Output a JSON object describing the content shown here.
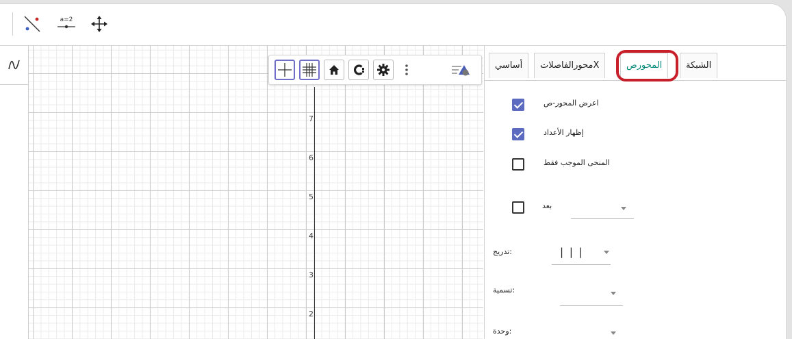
{
  "toolbar": {
    "tools": [
      "line-point-icon",
      "slider-icon",
      "move-graphics-icon"
    ],
    "slider_label": "a=2"
  },
  "algebra": {
    "icon": "function-icon"
  },
  "graphics": {
    "toolbar_buttons": [
      "axes-icon",
      "grid-icon",
      "home-icon",
      "c-icon",
      "settings-icon",
      "more-icon",
      "style-bar-icon"
    ],
    "y_ticks": [
      "7",
      "6",
      "5",
      "4",
      "3",
      "2"
    ]
  },
  "properties": {
    "tabs": {
      "grid": "الشبكة",
      "y_axis": "المحورص",
      "x_axis": "محورالفاصلاتX",
      "basic": "أساسي"
    },
    "show_y_axis": {
      "label": "اعرض المحور-ص",
      "checked": true
    },
    "show_numbers": {
      "label": "إظهار الأعداد",
      "checked": true
    },
    "positive_only": {
      "label": "المنحى الموجب فقط",
      "checked": false
    },
    "distance": {
      "label": "بعد",
      "checked": false,
      "value": ""
    },
    "ticks": {
      "label": ":تدريج",
      "value": "| | |"
    },
    "label_field": {
      "label": ":تسمية",
      "value": ""
    },
    "unit": {
      "label": ":وحدة",
      "value": ""
    }
  },
  "colors": {
    "accent": "#5c6bc0",
    "selected_tab": "#00897b",
    "highlight": "#c8202b"
  }
}
